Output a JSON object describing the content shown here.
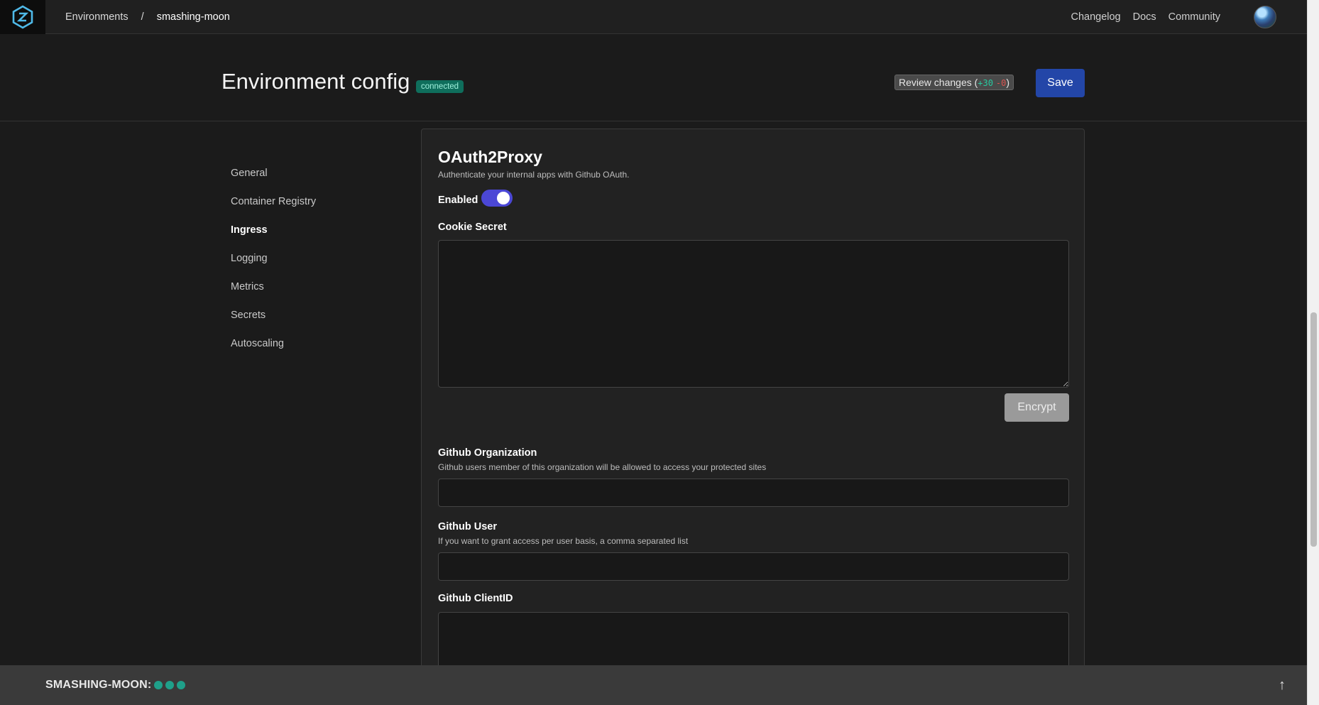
{
  "topnav": {
    "logo_icon": "app-logo-icon",
    "breadcrumb": [
      "Environments",
      "/",
      "smashing-moon"
    ],
    "links": [
      "Changelog",
      "Docs",
      "Community"
    ],
    "avatar": "user-avatar"
  },
  "header": {
    "title": "Environment config",
    "status": "connected",
    "review": {
      "label": "Review changes (",
      "added": "+30",
      "removed": "-0",
      "close": ")"
    },
    "save_label": "Save"
  },
  "sidebar": {
    "items": [
      {
        "label": "General",
        "active": false
      },
      {
        "label": "Container Registry",
        "active": false
      },
      {
        "label": "Ingress",
        "active": true
      },
      {
        "label": "Logging",
        "active": false
      },
      {
        "label": "Metrics",
        "active": false
      },
      {
        "label": "Secrets",
        "active": false
      },
      {
        "label": "Autoscaling",
        "active": false
      }
    ]
  },
  "card": {
    "title": "OAuth2Proxy",
    "description": "Authenticate your internal apps with Github OAuth.",
    "enabled_label": "Enabled",
    "enabled": true,
    "cookie_secret": {
      "label": "Cookie Secret",
      "value": ""
    },
    "encrypt_label": "Encrypt",
    "github_org": {
      "label": "Github Organization",
      "hint": "Github users member of this organization will be allowed to access your protected sites",
      "value": ""
    },
    "github_user": {
      "label": "Github User",
      "hint": "If you want to grant access per user basis, a comma separated list",
      "value": ""
    },
    "github_clientid": {
      "label": "Github ClientID",
      "value": ""
    }
  },
  "footer": {
    "env_label": "SMASHING-MOON:",
    "status_dots": 3,
    "dot_color": "#1fa08a",
    "scroll_top_icon": "arrow-up-icon"
  },
  "colors": {
    "accent": "#2346a8",
    "toggle": "#4b47d6",
    "badge": "#0f6e5c"
  }
}
